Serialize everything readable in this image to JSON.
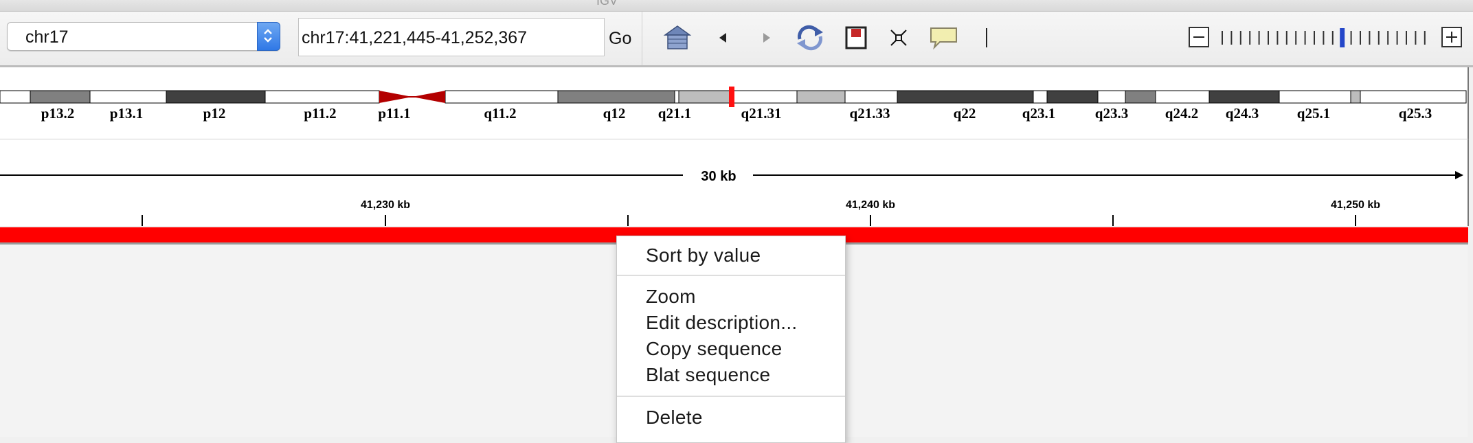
{
  "window": {
    "title": "IGV"
  },
  "toolbar": {
    "genome_value": "chr17",
    "locus": "chr17:41,221,445-41,252,367",
    "go_label": "Go",
    "icons": [
      "home-icon",
      "back-icon",
      "forward-icon",
      "refresh-icon",
      "roi-icon",
      "resize-icon",
      "popup-text-icon",
      "ruler-line-icon"
    ],
    "zoom": {
      "ticks": 23,
      "current_index": 13
    }
  },
  "ideogram": {
    "band_labels": [
      "p13.2",
      "p13.1",
      "p12",
      "p11.2",
      "p11.1",
      "q11.2",
      "q12",
      "q21.1",
      "q21.31",
      "q21.33",
      "q22",
      "q23.1",
      "q23.3",
      "q24.2",
      "q24.3",
      "q25.1",
      "q25.3"
    ]
  },
  "ruler": {
    "span_label": "30 kb",
    "tick_labels": [
      "41,230 kb",
      "41,240 kb",
      "41,250 kb"
    ]
  },
  "colors": {
    "feature": "#ff0000",
    "centromere": "#b30000",
    "current_region": "#ff1010",
    "zoom_thumb": "#2346c9"
  },
  "context_menu": {
    "sort": "Sort by value",
    "zoom": "Zoom",
    "edit": "Edit description...",
    "copy": "Copy sequence",
    "blat": "Blat sequence",
    "delete": "Delete"
  }
}
